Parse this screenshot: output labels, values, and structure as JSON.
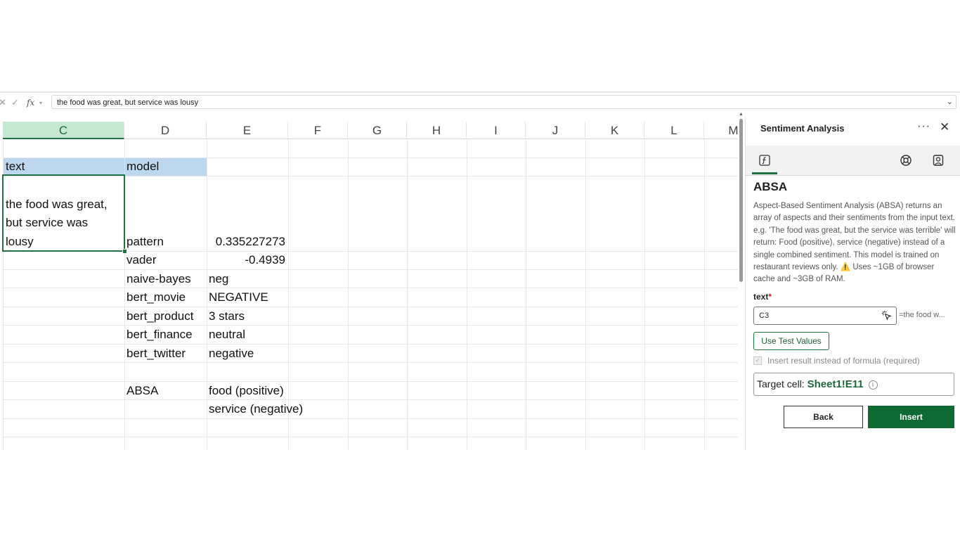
{
  "formula_bar": {
    "value": "the food was great, but service was lousy",
    "cancel_glyph": "✕",
    "enter_glyph": "✓",
    "fx_label": "fx",
    "expand_glyph": "⌄"
  },
  "columns": [
    "C",
    "D",
    "E",
    "F",
    "G",
    "H",
    "I",
    "J",
    "K",
    "L",
    "M"
  ],
  "selected_column": "C",
  "cells": {
    "c_header": "text",
    "d_header": "model",
    "c3_line1": "the food was great,",
    "c3_line2": "but service was",
    "c3_line3": "lousy",
    "models": [
      {
        "name": "pattern",
        "result": "0.335227273",
        "align": "right"
      },
      {
        "name": "vader",
        "result": "-0.4939",
        "align": "right"
      },
      {
        "name": "naive-bayes",
        "result": "neg",
        "align": "left"
      },
      {
        "name": "bert_movie",
        "result": "NEGATIVE",
        "align": "left"
      },
      {
        "name": "bert_product",
        "result": "3 stars",
        "align": "left"
      },
      {
        "name": "bert_finance",
        "result": "neutral",
        "align": "left"
      },
      {
        "name": "bert_twitter",
        "result": "negative",
        "align": "left"
      }
    ],
    "absa_label": "ABSA",
    "absa_results": [
      "food (positive)",
      "service (negative)"
    ]
  },
  "panel": {
    "title": "Sentiment Analysis",
    "more_glyph": "···",
    "close_glyph": "✕",
    "model_name": "ABSA",
    "description": "Aspect-Based Sentiment Analysis (ABSA) returns an array of aspects and their sentiments from the input text. e.g. 'The food was great, but the service was terrible' will return: Food (positive), service (negative) instead of a single combined sentiment. This model is trained on restaurant reviews only.",
    "warning_glyph": "⚠️",
    "description_tail": "Uses ~1GB of browser cache and ~3GB of RAM.",
    "field_label": "text",
    "required_mark": "*",
    "field_value": "C3",
    "field_preview": "=the food w...",
    "test_button": "Use Test Values",
    "checkbox_label": "Insert result instead of formula (required)",
    "checkbox_glyph": "✓",
    "target_label": "Target cell:",
    "target_value": "Sheet1!E11",
    "info_glyph": "i",
    "back_button": "Back",
    "insert_button": "Insert"
  },
  "colors": {
    "accent": "#217346",
    "header_fill": "#bdd7ee",
    "selected_col": "#c6e7d2",
    "insert_btn": "#0d6a33"
  }
}
